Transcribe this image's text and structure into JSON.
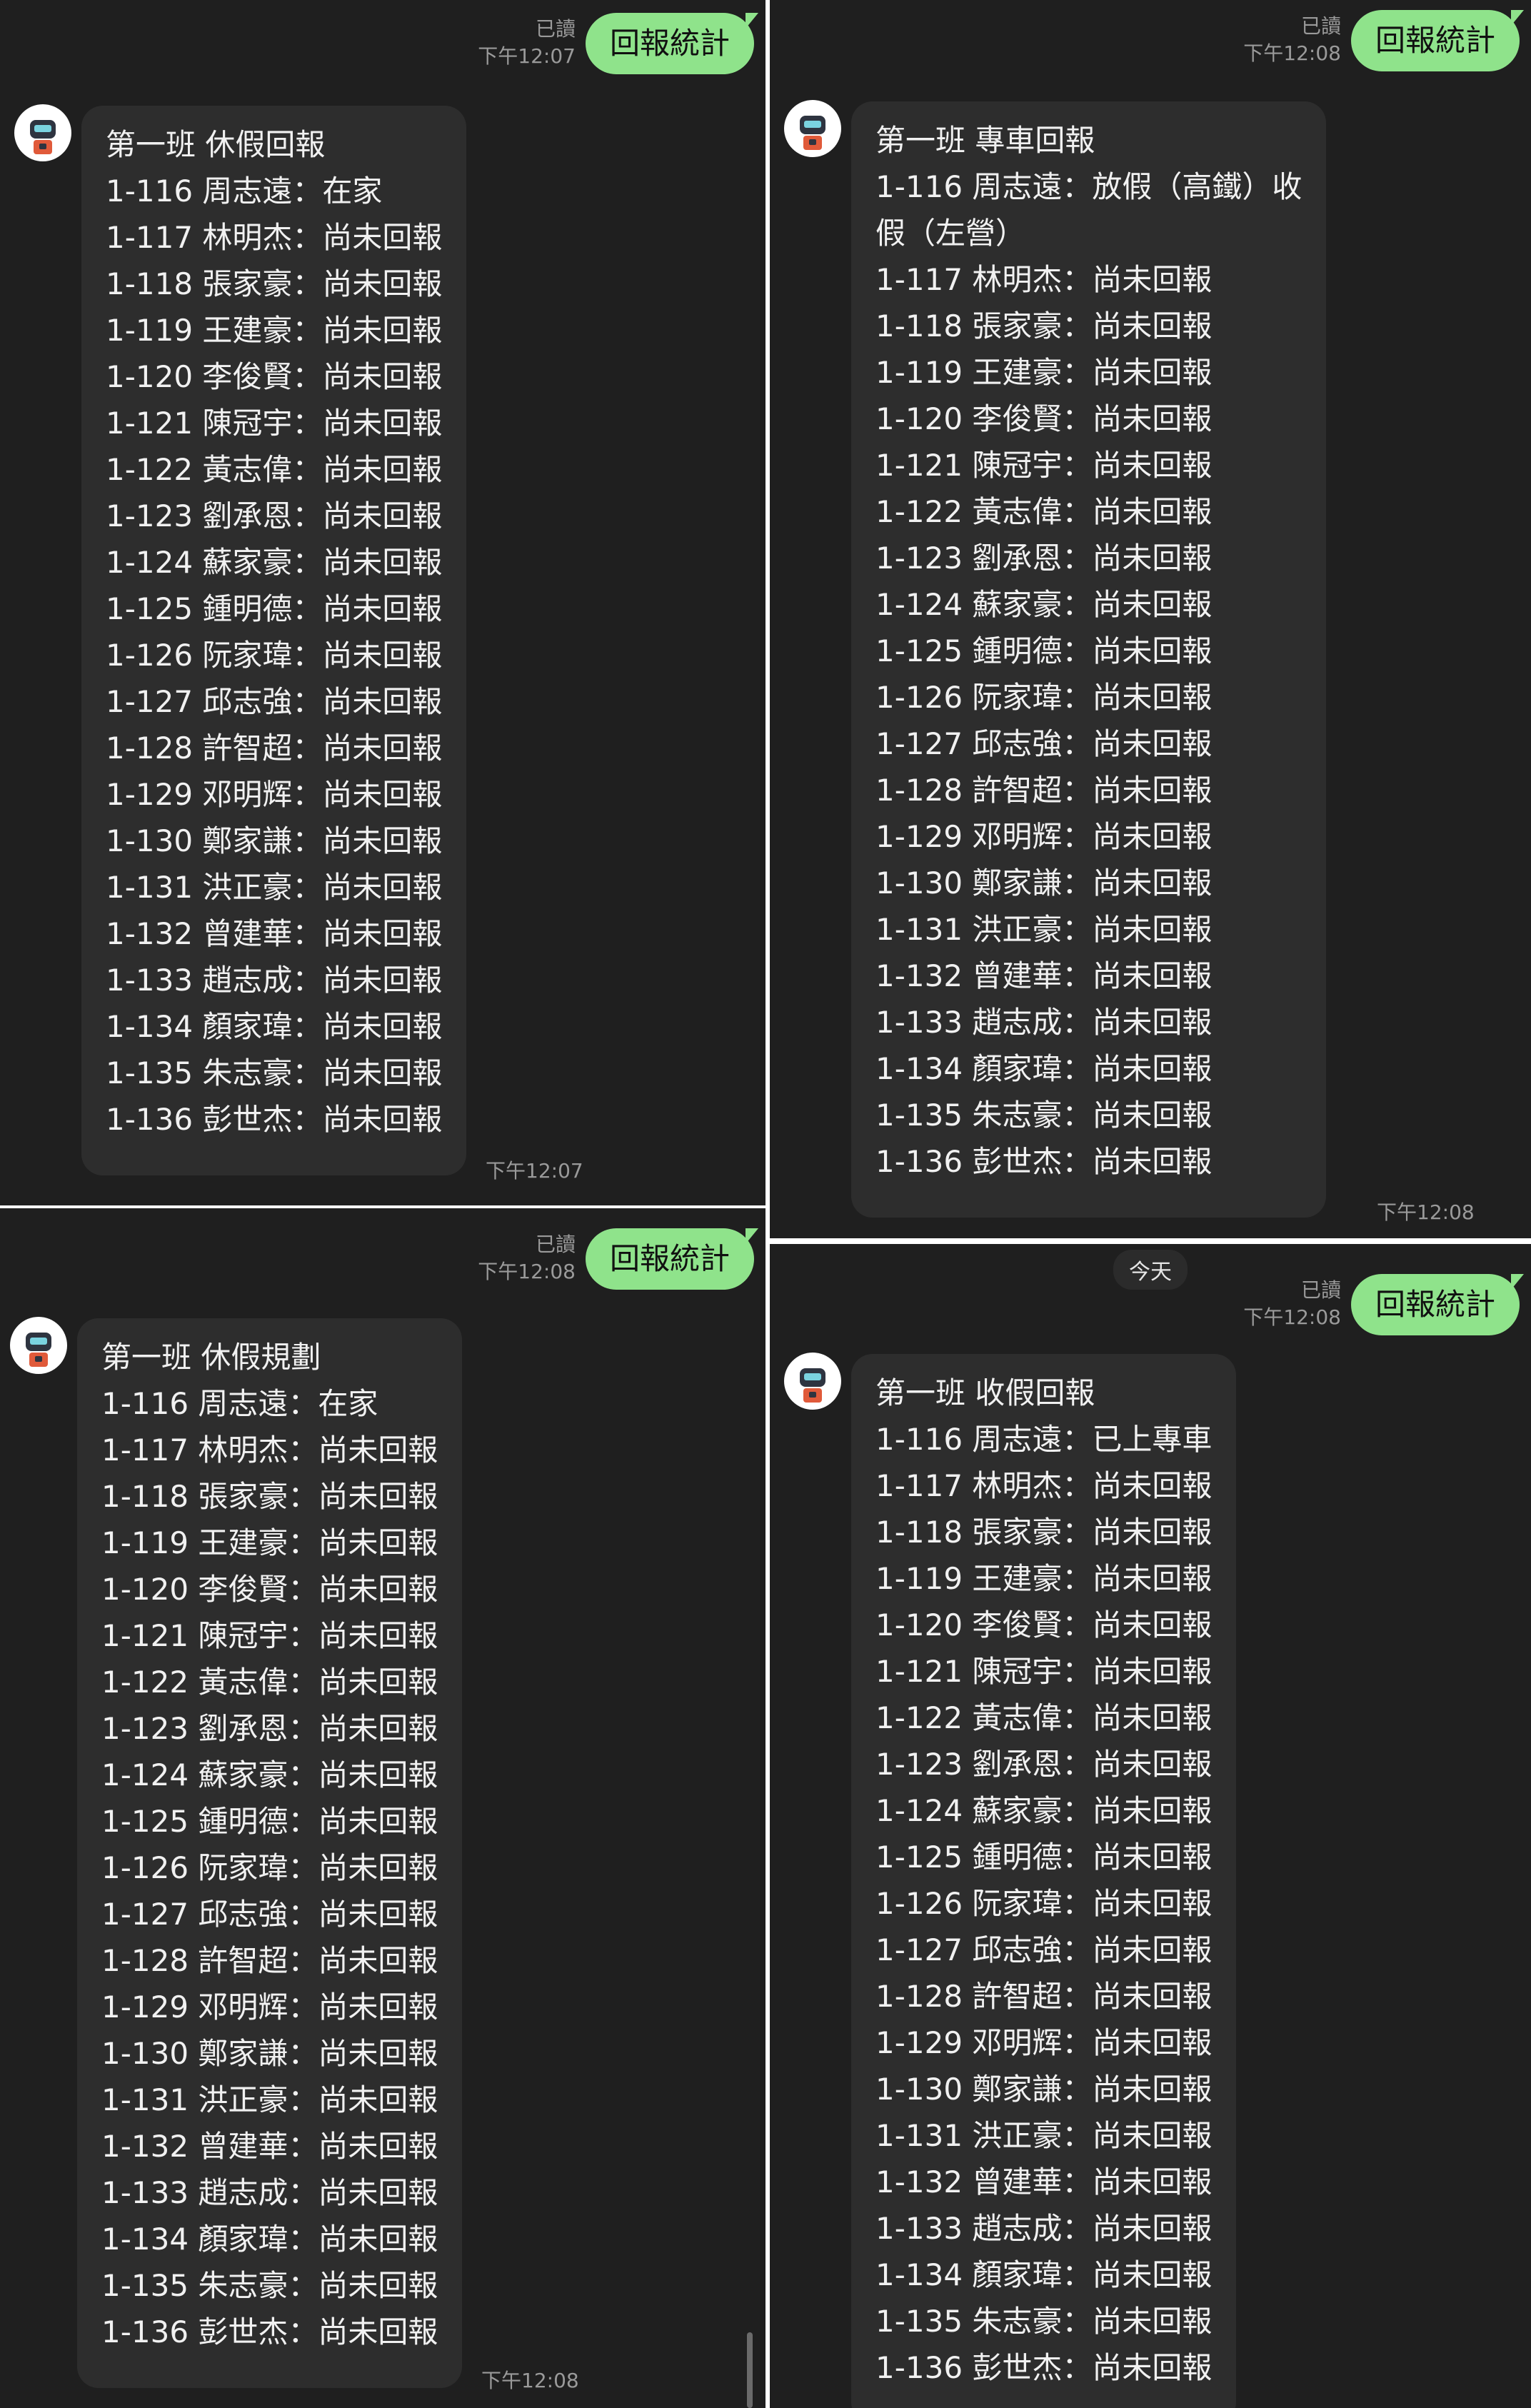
{
  "colors": {
    "background": "#1f1f1f",
    "sent_bubble": "#8fe38b",
    "recv_bubble": "#2d2d2d"
  },
  "panels": [
    {
      "read": "已讀",
      "sent_time": "下午12:07",
      "sent_text": "回報統計",
      "recv_time": "下午12:07",
      "lines": [
        "第一班 休假回報",
        "1-116 周志遠：在家",
        "1-117 林明杰：尚未回報",
        "1-118 張家豪：尚未回報",
        "1-119 王建豪：尚未回報",
        "1-120 李俊賢：尚未回報",
        "1-121 陳冠宇：尚未回報",
        "1-122 黃志偉：尚未回報",
        "1-123 劉承恩：尚未回報",
        "1-124 蘇家豪：尚未回報",
        "1-125 鍾明德：尚未回報",
        "1-126 阮家瑋：尚未回報",
        "1-127 邱志強：尚未回報",
        "1-128 許智超：尚未回報",
        "1-129 邓明辉：尚未回報",
        "1-130 鄭家謙：尚未回報",
        "1-131 洪正豪：尚未回報",
        "1-132 曾建華：尚未回報",
        "1-133 趙志成：尚未回報",
        "1-134 顏家瑋：尚未回報",
        "1-135 朱志豪：尚未回報",
        "1-136 彭世杰：尚未回報"
      ]
    },
    {
      "read": "已讀",
      "sent_time": "下午12:08",
      "sent_text": "回報統計",
      "recv_time": "下午12:08",
      "lines": [
        "第一班 專車回報",
        "1-116 周志遠：放假（高鐵）收",
        "假（左營）",
        "1-117 林明杰：尚未回報",
        "1-118 張家豪：尚未回報",
        "1-119 王建豪：尚未回報",
        "1-120 李俊賢：尚未回報",
        "1-121 陳冠宇：尚未回報",
        "1-122 黃志偉：尚未回報",
        "1-123 劉承恩：尚未回報",
        "1-124 蘇家豪：尚未回報",
        "1-125 鍾明德：尚未回報",
        "1-126 阮家瑋：尚未回報",
        "1-127 邱志強：尚未回報",
        "1-128 許智超：尚未回報",
        "1-129 邓明辉：尚未回報",
        "1-130 鄭家謙：尚未回報",
        "1-131 洪正豪：尚未回報",
        "1-132 曾建華：尚未回報",
        "1-133 趙志成：尚未回報",
        "1-134 顏家瑋：尚未回報",
        "1-135 朱志豪：尚未回報",
        "1-136 彭世杰：尚未回報"
      ]
    },
    {
      "read": "已讀",
      "sent_time": "下午12:08",
      "sent_text": "回報統計",
      "recv_time": "下午12:08",
      "lines": [
        "第一班 休假規劃",
        "1-116 周志遠：在家",
        "1-117 林明杰：尚未回報",
        "1-118 張家豪：尚未回報",
        "1-119 王建豪：尚未回報",
        "1-120 李俊賢：尚未回報",
        "1-121 陳冠宇：尚未回報",
        "1-122 黃志偉：尚未回報",
        "1-123 劉承恩：尚未回報",
        "1-124 蘇家豪：尚未回報",
        "1-125 鍾明德：尚未回報",
        "1-126 阮家瑋：尚未回報",
        "1-127 邱志強：尚未回報",
        "1-128 許智超：尚未回報",
        "1-129 邓明辉：尚未回報",
        "1-130 鄭家謙：尚未回報",
        "1-131 洪正豪：尚未回報",
        "1-132 曾建華：尚未回報",
        "1-133 趙志成：尚未回報",
        "1-134 顏家瑋：尚未回報",
        "1-135 朱志豪：尚未回報",
        "1-136 彭世杰：尚未回報"
      ]
    },
    {
      "day_chip": "今天",
      "read": "已讀",
      "sent_time": "下午12:08",
      "sent_text": "回報統計",
      "lines": [
        "第一班 收假回報",
        "1-116 周志遠：已上專車",
        "1-117 林明杰：尚未回報",
        "1-118 張家豪：尚未回報",
        "1-119 王建豪：尚未回報",
        "1-120 李俊賢：尚未回報",
        "1-121 陳冠宇：尚未回報",
        "1-122 黃志偉：尚未回報",
        "1-123 劉承恩：尚未回報",
        "1-124 蘇家豪：尚未回報",
        "1-125 鍾明德：尚未回報",
        "1-126 阮家瑋：尚未回報",
        "1-127 邱志強：尚未回報",
        "1-128 許智超：尚未回報",
        "1-129 邓明辉：尚未回報",
        "1-130 鄭家謙：尚未回報",
        "1-131 洪正豪：尚未回報",
        "1-132 曾建華：尚未回報",
        "1-133 趙志成：尚未回報",
        "1-134 顏家瑋：尚未回報",
        "1-135 朱志豪：尚未回報",
        "1-136 彭世杰：尚未回報"
      ]
    }
  ]
}
